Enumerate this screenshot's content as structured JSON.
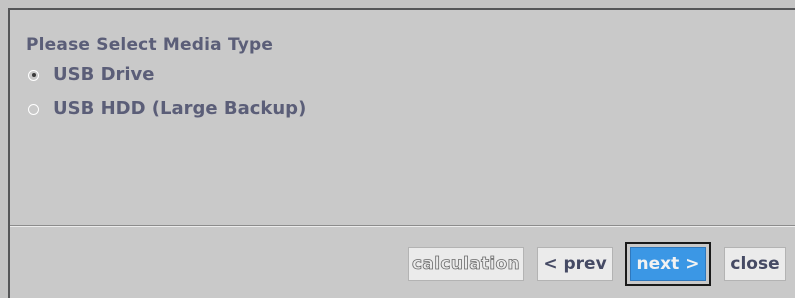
{
  "dialog": {
    "prompt": "Please Select Media Type",
    "options": [
      {
        "label": "USB Drive",
        "selected": true
      },
      {
        "label": "USB HDD (Large Backup)",
        "selected": false
      }
    ]
  },
  "footer": {
    "calculation_label": "calculation",
    "prev_label": "< prev",
    "next_label": "next >",
    "close_label": "close"
  },
  "colors": {
    "background": "#c9c9c9",
    "text": "#5b5e78",
    "button_face": "#ebebeb",
    "focus_button": "#3b97e5"
  }
}
